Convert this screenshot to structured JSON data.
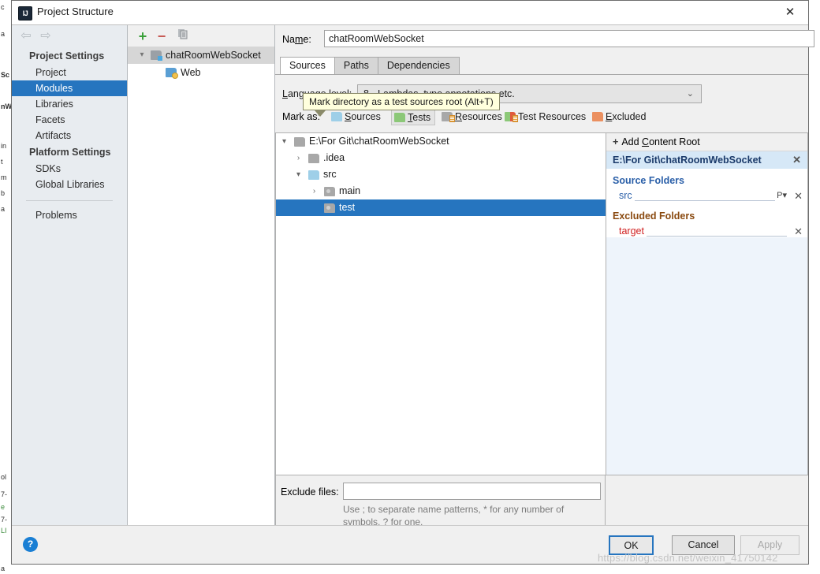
{
  "window": {
    "title": "Project Structure",
    "icon": "IJ",
    "close_label": "✕"
  },
  "nav": {
    "back_icon": "⇦",
    "forward_icon": "⇨"
  },
  "sidebar": {
    "groups": [
      {
        "title": "Project Settings",
        "items": [
          {
            "label": "Project",
            "selected": false
          },
          {
            "label": "Modules",
            "selected": true
          },
          {
            "label": "Libraries",
            "selected": false
          },
          {
            "label": "Facets",
            "selected": false
          },
          {
            "label": "Artifacts",
            "selected": false
          }
        ]
      },
      {
        "title": "Platform Settings",
        "items": [
          {
            "label": "SDKs",
            "selected": false
          },
          {
            "label": "Global Libraries",
            "selected": false
          }
        ]
      }
    ],
    "extra": [
      {
        "label": "Problems",
        "selected": false
      }
    ]
  },
  "module_panel": {
    "toolbar": {
      "add_label": "+",
      "remove_label": "−",
      "copy_label": "copy-icon"
    },
    "items": [
      {
        "label": "chatRoomWebSocket",
        "icon": "module-folder-icon",
        "expanded": true,
        "selected": true,
        "indent": 0
      },
      {
        "label": "Web",
        "icon": "web-facet-icon",
        "expanded": null,
        "selected": false,
        "indent": 1
      }
    ]
  },
  "editor": {
    "name_label": "Name:",
    "name_value": "chatRoomWebSocket",
    "tabs": [
      {
        "label": "Sources",
        "active": true
      },
      {
        "label": "Paths",
        "active": false
      },
      {
        "label": "Dependencies",
        "active": false
      }
    ],
    "language_level": {
      "label": "Language level:",
      "value": "8 - Lambdas, type annotations etc.",
      "caret": "⌄"
    },
    "mark_as": {
      "label": "Mark as:",
      "options": [
        {
          "label": "Sources",
          "color": "#9ecfe8",
          "style": "blue",
          "hover": false
        },
        {
          "label": "Tests",
          "color": "#8cc878",
          "style": "green",
          "hover": true
        },
        {
          "label": "Resources",
          "color": "#a8a8a8",
          "style": "gray-lines",
          "hover": false
        },
        {
          "label": "Test Resources",
          "color": "#8cc878",
          "style": "split-lines",
          "hover": false
        },
        {
          "label": "Excluded",
          "color": "#eb9060",
          "style": "orange",
          "hover": false
        }
      ]
    },
    "tooltip": "Mark directory as a test sources root (Alt+T)"
  },
  "tree": {
    "rows": [
      {
        "label": "E:\\For Git\\chatRoomWebSocket",
        "chevron": "⌄",
        "icon": "folder-icon",
        "indent": 0,
        "selected": false
      },
      {
        "label": ".idea",
        "chevron": "›",
        "icon": "folder-icon",
        "indent": 1,
        "selected": false
      },
      {
        "label": "src",
        "chevron": "⌄",
        "icon": "folder-source-icon",
        "indent": 1,
        "selected": false
      },
      {
        "label": "main",
        "chevron": "›",
        "icon": "folder-test-icon",
        "indent": 2,
        "selected": false
      },
      {
        "label": "test",
        "chevron": "",
        "icon": "folder-test-icon",
        "indent": 2,
        "selected": true
      }
    ]
  },
  "detail": {
    "add_content_root": "Add Content Root",
    "add_content_root_plus": "+",
    "content_root": "E:\\For Git\\chatRoomWebSocket",
    "close_icon": "✕",
    "sections": [
      {
        "title": "Source Folders",
        "kind": "source",
        "folders": [
          {
            "name": "src",
            "suffix": "P",
            "suffix_caret": "⌄",
            "remove": "✕"
          }
        ]
      },
      {
        "title": "Excluded Folders",
        "kind": "excluded",
        "folders": [
          {
            "name": "target",
            "suffix": "",
            "suffix_caret": "",
            "remove": "✕"
          }
        ]
      }
    ]
  },
  "exclude_files": {
    "label": "Exclude files:",
    "value": "",
    "placeholder": "",
    "hint_line1": "Use ; to separate name patterns, * for any number of",
    "hint_line2": "symbols, ? for one."
  },
  "footer": {
    "help_label": "?",
    "buttons": [
      {
        "label": "OK",
        "state": "default"
      },
      {
        "label": "Cancel",
        "state": "normal"
      },
      {
        "label": "Apply",
        "state": "disabled"
      }
    ]
  },
  "watermark": "https://blog.csdn.net/weixin_41750142",
  "colors": {
    "accent_blue": "#2675bf",
    "sidebar_bg": "#e8ecf0",
    "dialog_bg": "#f0f0f0",
    "source_blue": "#2a5fa8",
    "excluded_red": "#d02020",
    "excluded_brown": "#8a4a10",
    "tooltip_bg": "#ffffdd"
  }
}
